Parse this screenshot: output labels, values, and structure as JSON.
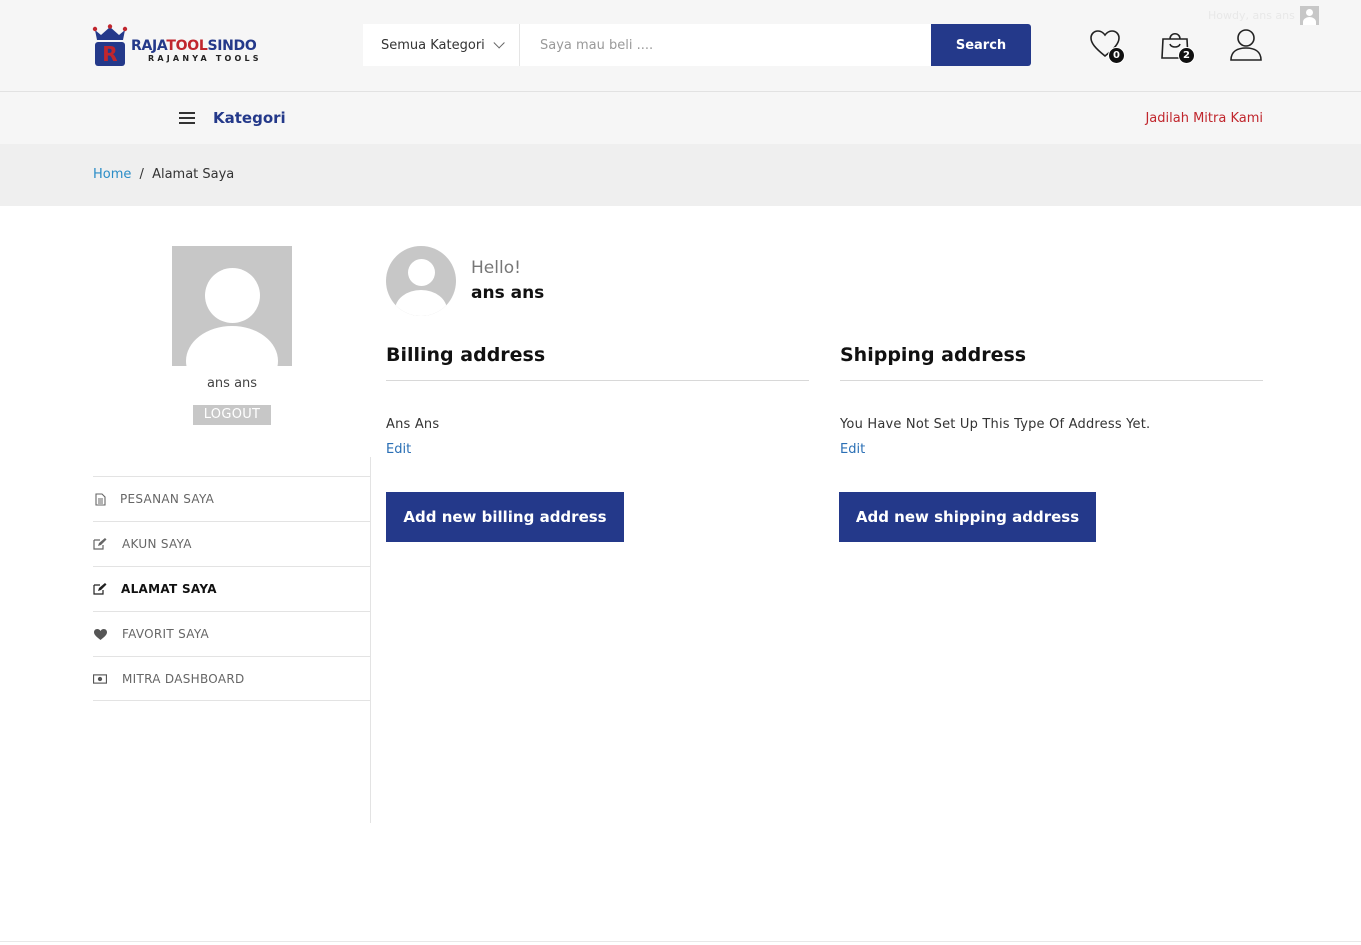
{
  "header": {
    "logo_text_primary": "RAJA",
    "logo_text_accent": "TOOL",
    "logo_text_secondary": "SINDO",
    "logo_tagline": "RAJANYA TOOLS",
    "category_select": "Semua Kategori",
    "search_placeholder": "Saya mau beli ....",
    "search_button": "Search",
    "howdy_text": "Howdy, ans ans",
    "wishlist_count": "0",
    "cart_count": "2"
  },
  "navbar": {
    "kategori_label": "Kategori",
    "mitra_link": "Jadilah Mitra Kami"
  },
  "breadcrumb": {
    "home": "Home",
    "separator": "/",
    "current": "Alamat Saya"
  },
  "sidebar": {
    "user_name": "ans ans",
    "logout_label": "LOGOUT",
    "items": [
      {
        "label": "PESANAN SAYA",
        "icon": "document-icon"
      },
      {
        "label": "AKUN SAYA",
        "icon": "edit-icon"
      },
      {
        "label": "ALAMAT SAYA",
        "icon": "edit-icon",
        "active": true
      },
      {
        "label": "FAVORIT SAYA",
        "icon": "heart-icon"
      },
      {
        "label": "MITRA DASHBOARD",
        "icon": "money-icon"
      }
    ]
  },
  "main": {
    "greeting": "Hello!",
    "user_name": "ans ans",
    "billing": {
      "title": "Billing address",
      "address": "Ans Ans",
      "edit_label": "Edit",
      "add_button": "Add new billing address"
    },
    "shipping": {
      "title": "Shipping address",
      "address": "You Have Not Set Up This Type Of Address Yet.",
      "edit_label": "Edit",
      "add_button": "Add new shipping address"
    }
  },
  "colors": {
    "brand_blue": "#24398a",
    "brand_red": "#c0262d",
    "link_blue": "#2a8dc7"
  }
}
